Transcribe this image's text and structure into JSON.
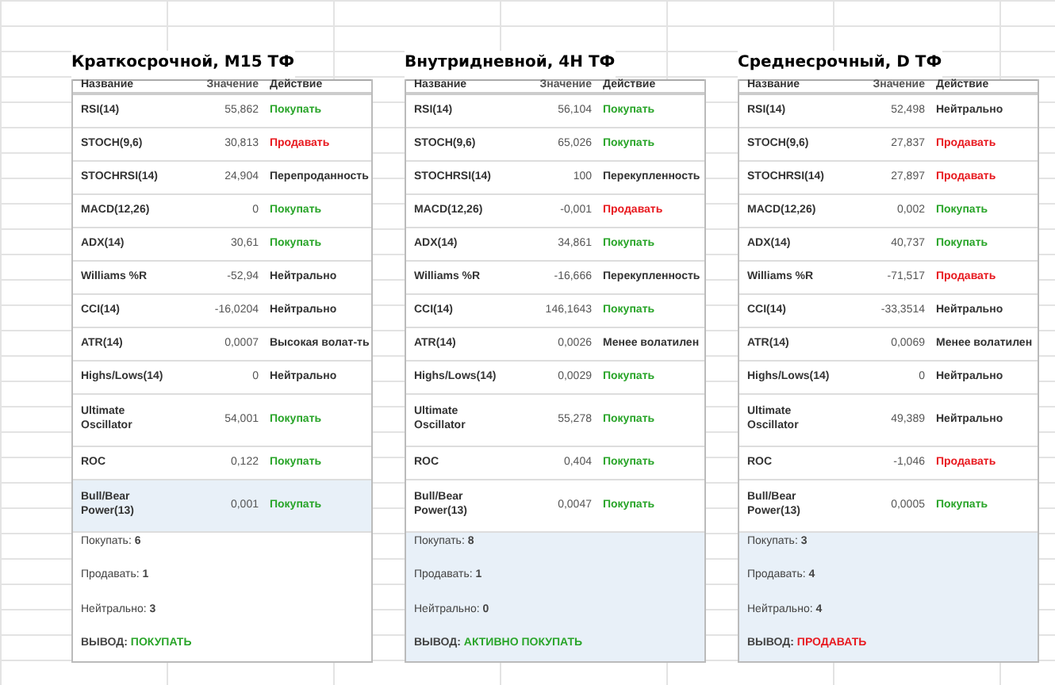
{
  "panels": [
    {
      "title": "Краткосрочной, M15 ТФ",
      "columns": [
        "Название",
        "Значение",
        "Действие"
      ],
      "rows": [
        {
          "name": "RSI(14)",
          "value": "55,862",
          "action": "Покупать",
          "kind": "buy",
          "highlighted": false
        },
        {
          "name": "STOCH(9,6)",
          "value": "30,813",
          "action": "Продавать",
          "kind": "sell",
          "highlighted": false
        },
        {
          "name": "STOCHRSI(14)",
          "value": "24,904",
          "action": "Перепроданность",
          "kind": "neutral",
          "highlighted": false
        },
        {
          "name": "MACD(12,26)",
          "value": "0",
          "action": "Покупать",
          "kind": "buy",
          "highlighted": false
        },
        {
          "name": "ADX(14)",
          "value": "30,61",
          "action": "Покупать",
          "kind": "buy",
          "highlighted": false
        },
        {
          "name": "Williams %R",
          "value": "-52,94",
          "action": "Нейтрально",
          "kind": "neutral",
          "highlighted": false
        },
        {
          "name": "CCI(14)",
          "value": "-16,0204",
          "action": "Нейтрально",
          "kind": "neutral",
          "highlighted": false
        },
        {
          "name": "ATR(14)",
          "value": "0,0007",
          "action": "Высокая волат-ть",
          "kind": "neutral",
          "highlighted": false
        },
        {
          "name": "Highs/Lows(14)",
          "value": "0",
          "action": "Нейтрально",
          "kind": "neutral",
          "highlighted": false
        },
        {
          "name": "Ultimate Oscillator",
          "value": "54,001",
          "action": "Покупать",
          "kind": "buy",
          "highlighted": false
        },
        {
          "name": "ROC",
          "value": "0,122",
          "action": "Покупать",
          "kind": "buy",
          "highlighted": false
        },
        {
          "name": "Bull/Bear Power(13)",
          "value": "0,001",
          "action": "Покупать",
          "kind": "buy",
          "highlighted": true
        }
      ],
      "summary": {
        "highlighted": false,
        "lines": [
          "Покупать: **6**",
          "Продавать: **1**",
          "Нейтрально: **3**"
        ],
        "conclusion_label": "ВЫВОД:",
        "conclusion": "ПОКУПАТЬ",
        "conclusion_bearish": false
      }
    },
    {
      "title": "Внутридневной, 4H ТФ",
      "columns": [
        "Название",
        "Значение",
        "Действие"
      ],
      "rows": [
        {
          "name": "RSI(14)",
          "value": "56,104",
          "action": "Покупать",
          "kind": "buy",
          "highlighted": false
        },
        {
          "name": "STOCH(9,6)",
          "value": "65,026",
          "action": "Покупать",
          "kind": "buy",
          "highlighted": false
        },
        {
          "name": "STOCHRSI(14)",
          "value": "100",
          "action": "Перекупленность",
          "kind": "neutral",
          "highlighted": false
        },
        {
          "name": "MACD(12,26)",
          "value": "-0,001",
          "action": "Продавать",
          "kind": "sell",
          "highlighted": false
        },
        {
          "name": "ADX(14)",
          "value": "34,861",
          "action": "Покупать",
          "kind": "buy",
          "highlighted": false
        },
        {
          "name": "Williams %R",
          "value": "-16,666",
          "action": "Перекупленность",
          "kind": "neutral",
          "highlighted": false
        },
        {
          "name": "CCI(14)",
          "value": "146,1643",
          "action": "Покупать",
          "kind": "buy",
          "highlighted": false
        },
        {
          "name": "ATR(14)",
          "value": "0,0026",
          "action": "Менее волатилен",
          "kind": "neutral",
          "highlighted": false
        },
        {
          "name": "Highs/Lows(14)",
          "value": "0,0029",
          "action": "Покупать",
          "kind": "buy",
          "highlighted": false
        },
        {
          "name": "Ultimate Oscillator",
          "value": "55,278",
          "action": "Покупать",
          "kind": "buy",
          "highlighted": false
        },
        {
          "name": "ROC",
          "value": "0,404",
          "action": "Покупать",
          "kind": "buy",
          "highlighted": false
        },
        {
          "name": "Bull/Bear Power(13)",
          "value": "0,0047",
          "action": "Покупать",
          "kind": "buy",
          "highlighted": false
        }
      ],
      "summary": {
        "highlighted": true,
        "lines": [
          "Покупать: **8**",
          "Продавать: **1**",
          "Нейтрально: **0**"
        ],
        "conclusion_label": "ВЫВОД:",
        "conclusion": "АКТИВНО ПОКУПАТЬ",
        "conclusion_bearish": false
      }
    },
    {
      "title": "Среднесрочный, D ТФ",
      "columns": [
        "Название",
        "Значение",
        "Действие"
      ],
      "rows": [
        {
          "name": "RSI(14)",
          "value": "52,498",
          "action": "Нейтрально",
          "kind": "neutral",
          "highlighted": false
        },
        {
          "name": "STOCH(9,6)",
          "value": "27,837",
          "action": "Продавать",
          "kind": "sell",
          "highlighted": false
        },
        {
          "name": "STOCHRSI(14)",
          "value": "27,897",
          "action": "Продавать",
          "kind": "sell",
          "highlighted": false
        },
        {
          "name": "MACD(12,26)",
          "value": "0,002",
          "action": "Покупать",
          "kind": "buy",
          "highlighted": false
        },
        {
          "name": "ADX(14)",
          "value": "40,737",
          "action": "Покупать",
          "kind": "buy",
          "highlighted": false
        },
        {
          "name": "Williams %R",
          "value": "-71,517",
          "action": "Продавать",
          "kind": "sell",
          "highlighted": false
        },
        {
          "name": "CCI(14)",
          "value": "-33,3514",
          "action": "Нейтрально",
          "kind": "neutral",
          "highlighted": false
        },
        {
          "name": "ATR(14)",
          "value": "0,0069",
          "action": "Менее волатилен",
          "kind": "neutral",
          "highlighted": false
        },
        {
          "name": "Highs/Lows(14)",
          "value": "0",
          "action": "Нейтрально",
          "kind": "neutral",
          "highlighted": false
        },
        {
          "name": "Ultimate Oscillator",
          "value": "49,389",
          "action": "Нейтрально",
          "kind": "neutral",
          "highlighted": false
        },
        {
          "name": "ROC",
          "value": "-1,046",
          "action": "Продавать",
          "kind": "sell",
          "highlighted": false
        },
        {
          "name": "Bull/Bear Power(13)",
          "value": "0,0005",
          "action": "Покупать",
          "kind": "buy",
          "highlighted": false
        }
      ],
      "summary": {
        "highlighted": true,
        "lines": [
          "Покупать: **3**",
          "Продавать: **4**",
          "Нейтрально: **4**"
        ],
        "conclusion_label": "ВЫВОД:",
        "conclusion": "ПРОДАВАТЬ",
        "conclusion_bearish": true
      }
    }
  ]
}
